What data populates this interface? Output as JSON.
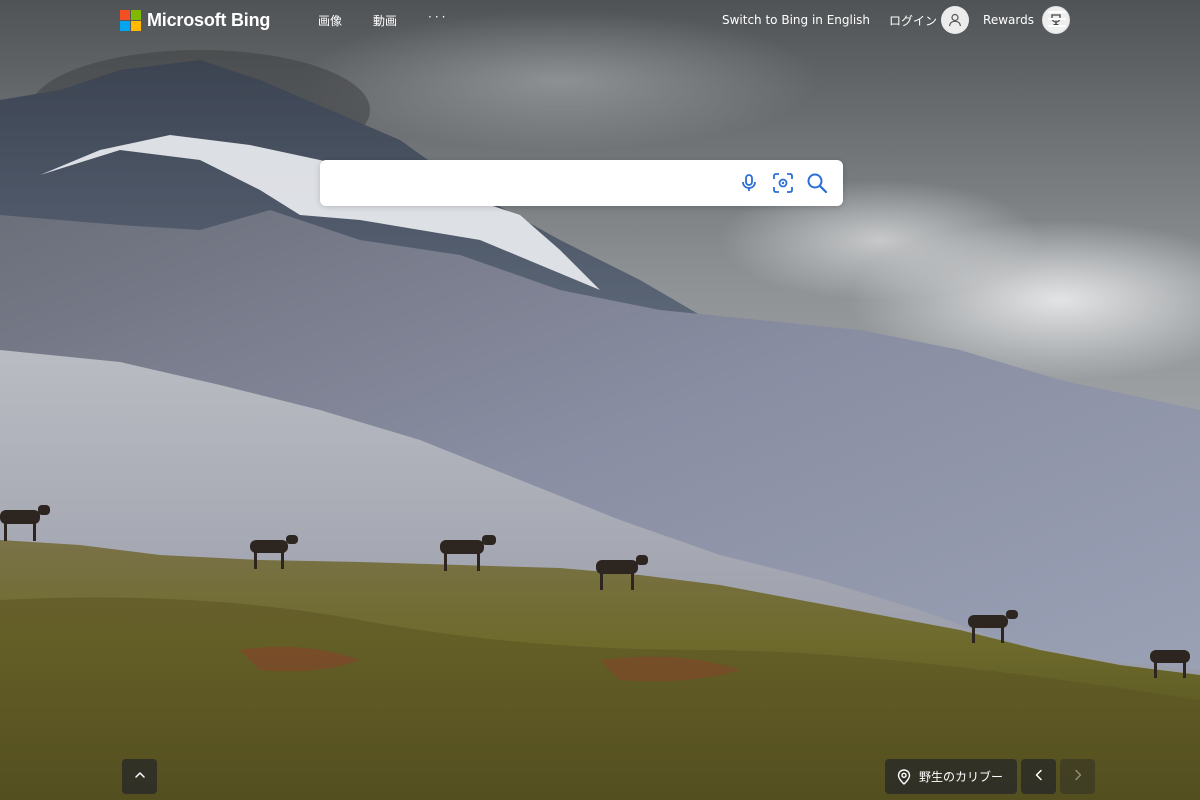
{
  "colors": {
    "ms_red": "#f25022",
    "ms_green": "#7fba00",
    "ms_blue": "#00a4ef",
    "ms_yellow": "#ffb900",
    "search_icon_blue": "#2b6fd6"
  },
  "header": {
    "brand": "Microsoft Bing",
    "nav": [
      {
        "label": "画像"
      },
      {
        "label": "動画"
      },
      {
        "label": "···"
      }
    ],
    "switch_language": "Switch to Bing in English",
    "login_label": "ログイン",
    "rewards_label": "Rewards"
  },
  "search": {
    "value": "",
    "icons": [
      "microphone-icon",
      "visual-search-icon",
      "search-icon"
    ]
  },
  "footer": {
    "image_caption": "野生のカリブー"
  }
}
